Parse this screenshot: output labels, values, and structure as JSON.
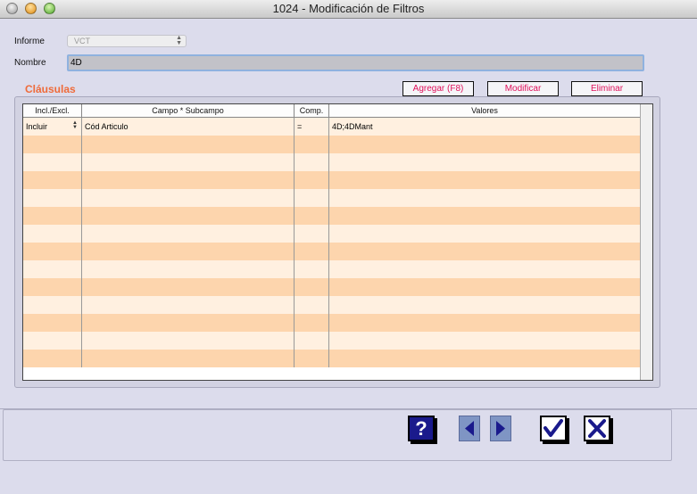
{
  "window": {
    "title": "1024 - Modificación de Filtros"
  },
  "form": {
    "informe_label": "Informe",
    "informe_value": "VCT",
    "nombre_label": "Nombre",
    "nombre_value": "4D"
  },
  "clausulas": {
    "title": "Cláusulas",
    "buttons": {
      "add": "Agregar (F8)",
      "modify": "Modificar",
      "delete": "Eliminar"
    },
    "columns": [
      "Incl./Excl.",
      "Campo * Subcampo",
      "Comp.",
      "Valores"
    ],
    "rows": [
      {
        "incl": "Incluir",
        "campo": "Cód Articulo",
        "comp": "=",
        "valores": "4D;4DMant"
      }
    ]
  },
  "footer": {
    "help_icon": "help-icon",
    "prev_icon": "arrow-left-icon",
    "next_icon": "arrow-right-icon",
    "ok_icon": "checkmark-icon",
    "cancel_icon": "x-icon"
  },
  "colors": {
    "accent": "#ef6b3a",
    "button_text": "#e0105a",
    "row_light": "#fff0e0",
    "row_dark": "#fdd5ad"
  }
}
